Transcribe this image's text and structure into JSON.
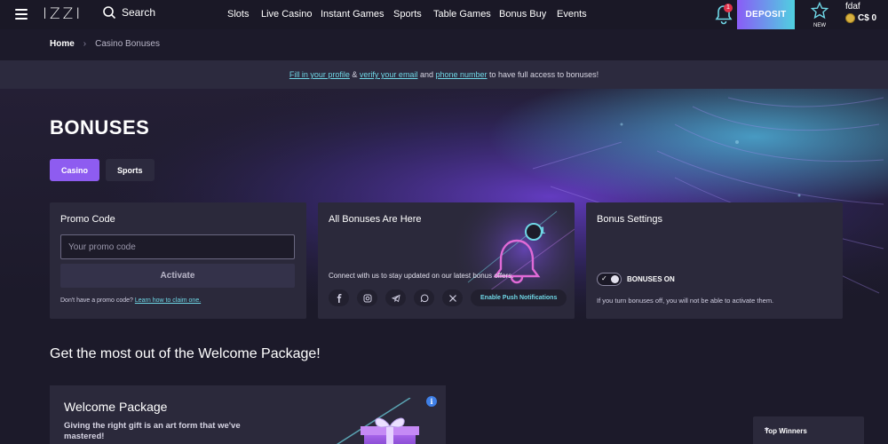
{
  "header": {
    "logo": "IZZI",
    "search_label": "Search",
    "menu": [
      "Slots",
      "Live Casino",
      "Instant Games",
      "Sports",
      "Table Games",
      "Bonus Buy",
      "Events"
    ],
    "notification_count": "1",
    "deposit_label": "DEPOSIT",
    "new_label": "NEW",
    "username": "fdaf",
    "balance": "C$ 0"
  },
  "breadcrumb": {
    "home": "Home",
    "separator": "›",
    "current": "Casino Bonuses"
  },
  "notice": {
    "link1": "Fill in your profile",
    "amp": " & ",
    "link2": "verify your email",
    "and": " and ",
    "link3": "phone number",
    "rest": " to have full access to bonuses!"
  },
  "page": {
    "title": "BONUSES",
    "tabs": [
      {
        "label": "Casino",
        "active": true
      },
      {
        "label": "Sports",
        "active": false
      }
    ]
  },
  "promo": {
    "title": "Promo Code",
    "placeholder": "Your promo code",
    "button": "Activate",
    "help_text": "Don't have a promo code?",
    "help_link": "Learn how to claim one."
  },
  "all_bonuses": {
    "title": "All Bonuses Are Here",
    "badge": "1",
    "connect_text": "Connect with us to stay updated on our latest bonus offers.",
    "socials": [
      "facebook-icon",
      "instagram-icon",
      "telegram-icon",
      "whatsapp-icon",
      "x-icon"
    ],
    "push_button": "Enable Push Notifications"
  },
  "settings": {
    "title": "Bonus Settings",
    "toggle_label": "BONUSES ON",
    "toggle_on": true,
    "note": "If you turn bonuses off, you will not be able to activate them."
  },
  "welcome": {
    "heading": "Get the most out of the Welcome Package!",
    "card_title": "Welcome Package",
    "card_text": "Giving the right gift is an art form that we've mastered!"
  },
  "winners": {
    "label": "Top Winners",
    "chevron": "^"
  },
  "colors": {
    "accent": "#8e5cf0",
    "cyan": "#6fd7e6",
    "panel": "#2b293b",
    "bg": "#1c1a2a"
  }
}
